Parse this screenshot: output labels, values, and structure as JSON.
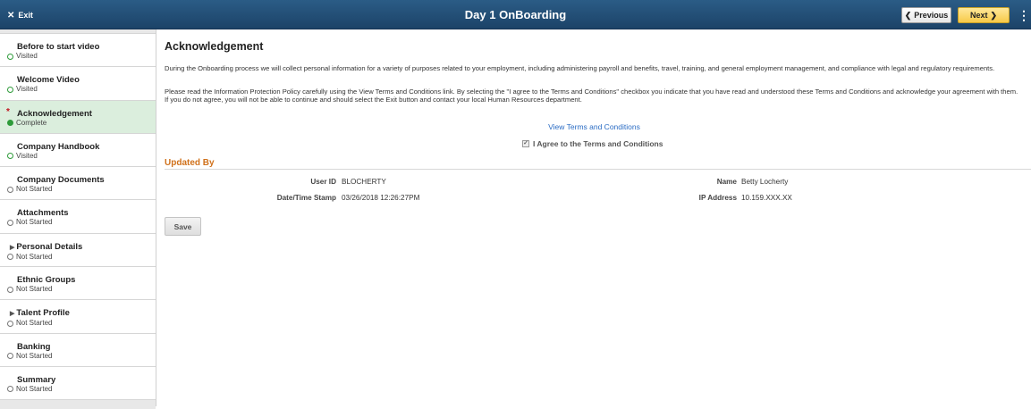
{
  "header": {
    "exit_label": "Exit",
    "title": "Day 1 OnBoarding",
    "previous_label": "Previous",
    "next_label": "Next",
    "menu_icon": "vertical-ellipsis-icon"
  },
  "sidebar": {
    "steps": [
      {
        "title": "Before to start video",
        "status": "Visited"
      },
      {
        "title": "Welcome Video",
        "status": "Visited"
      },
      {
        "title": "Acknowledgement",
        "status": "Complete"
      },
      {
        "title": "Company Handbook",
        "status": "Visited"
      },
      {
        "title": "Company Documents",
        "status": "Not Started"
      },
      {
        "title": "Attachments",
        "status": "Not Started"
      },
      {
        "title": "Personal Details",
        "status": "Not Started"
      },
      {
        "title": "Ethnic Groups",
        "status": "Not Started"
      },
      {
        "title": "Talent Profile",
        "status": "Not Started"
      },
      {
        "title": "Banking",
        "status": "Not Started"
      },
      {
        "title": "Summary",
        "status": "Not Started"
      }
    ],
    "required_mark": "*"
  },
  "main": {
    "title": "Acknowledgement",
    "paragraph1": "During the Onboarding process we will collect personal information for a variety of purposes related to your employment, including administering payroll and benefits, travel, training, and general employment management, and compliance with legal and regulatory requirements.",
    "paragraph2": "Please read the Information Protection Policy carefully using the View Terms and Conditions link. By selecting the \"I agree to the Terms and Conditions\" checkbox you indicate that you have read and understood these Terms and Conditions and acknowledge your agreement with them. If you do not agree, you will not be able to continue and should select the Exit button and contact your local Human Resources department.",
    "terms_link": "View Terms and Conditions",
    "agree_label": "I Agree to the Terms and Conditions",
    "agree_checked": true,
    "updated_by_heading": "Updated By",
    "user_id_label": "User ID",
    "user_id_value": "BLOCHERTY",
    "timestamp_label": "Date/Time Stamp",
    "timestamp_value": "03/26/2018 12:26:27PM",
    "name_label": "Name",
    "name_value": "Betty Locherty",
    "ip_label": "IP Address",
    "ip_value": "10.159.XXX.XX",
    "save_label": "Save"
  },
  "colors": {
    "banner": "#1c4368",
    "next_button": "#f7c948",
    "active_step": "#dbeedd",
    "section_heading": "#d0711b",
    "link": "#2b6cc4",
    "visited_dot": "#2e9b3a",
    "required_star": "#c0151f"
  }
}
